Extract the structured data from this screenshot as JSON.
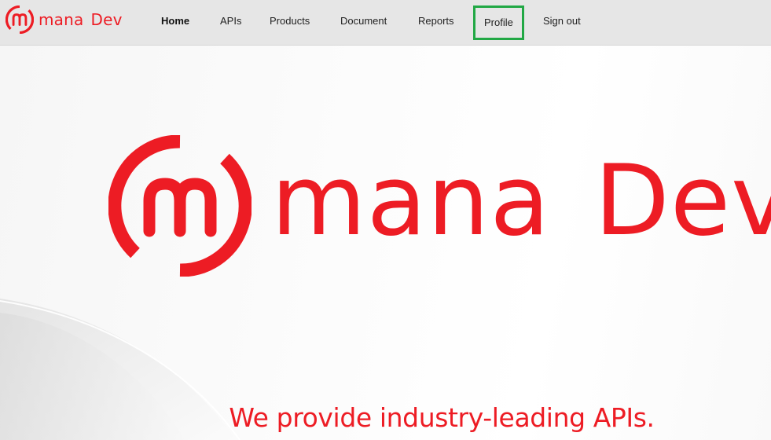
{
  "header": {
    "brand": {
      "word1": "mana",
      "word2": "Dev"
    },
    "nav": [
      {
        "label": "Home",
        "active": true
      },
      {
        "label": "APIs"
      },
      {
        "label": "Products"
      },
      {
        "label": "Document"
      },
      {
        "label": "Reports"
      },
      {
        "label": "Profile",
        "highlighted": true
      },
      {
        "label": "Sign out"
      }
    ]
  },
  "hero": {
    "wordmark": {
      "word1": "mana",
      "word2": "Dev"
    },
    "tagline": "We provide industry-leading APIs."
  },
  "colors": {
    "brand": "#ed1c24",
    "highlight": "#22a845",
    "navbar_bg": "#e6e6e6"
  }
}
